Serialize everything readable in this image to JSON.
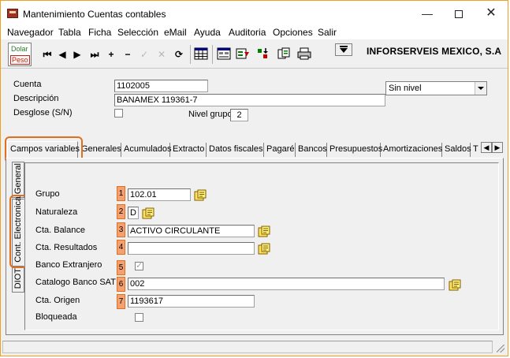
{
  "window": {
    "title": "Mantenimiento Cuentas contables",
    "minimize": "—",
    "close": "✕"
  },
  "menu": [
    "Navegador",
    "Tabla",
    "Ficha",
    "Selección",
    "eMail",
    "Ayuda",
    "Auditoria",
    "Opciones",
    "Salir"
  ],
  "toolbar": {
    "currency_dolar": "Dolar",
    "currency_peso": "Peso",
    "nav_buttons": [
      "⏮",
      "◀",
      "▶",
      "⏭",
      "+",
      "−",
      "✓",
      "✕",
      "⟳"
    ],
    "company": "INFORSERVEIS MEXICO, S.A"
  },
  "form": {
    "cuenta_label": "Cuenta",
    "cuenta_value": "1102005",
    "descripcion_label": "Descripción",
    "descripcion_value": "BANAMEX 119361-7",
    "desglose_label": "Desglose (S/N)",
    "nivel_grupo_label": "Nivel grupo",
    "nivel_grupo_value": "2",
    "nivel_select": "Sin nivel"
  },
  "tabs": [
    "Campos variables",
    "Generales",
    "Acumulados",
    "Extracto",
    "Datos fiscales",
    "Pagaré",
    "Bancos",
    "Presupuestos",
    "Amortizaciones",
    "Saldos",
    "T"
  ],
  "vertical_tabs": [
    "General",
    "Cont. Electronica",
    "DIOT"
  ],
  "fields": [
    {
      "label": "Grupo",
      "num": "1",
      "value": "102.01"
    },
    {
      "label": "Naturaleza",
      "num": "2",
      "value": "D"
    },
    {
      "label": "Cta. Balance",
      "num": "3",
      "value": "ACTIVO CIRCULANTE"
    },
    {
      "label": "Cta. Resultados",
      "num": "4",
      "value": ""
    },
    {
      "label": "Banco Extranjero",
      "num": "5",
      "value": ""
    },
    {
      "label": "Catalogo Banco SAT",
      "num": "6",
      "value": "002"
    },
    {
      "label": "Cta. Origen",
      "num": "7",
      "value": "1193617"
    },
    {
      "label": "Bloqueada",
      "num": "",
      "value": ""
    }
  ],
  "colors": {
    "highlight": "#e07020",
    "number_badge": "#f5a070"
  }
}
